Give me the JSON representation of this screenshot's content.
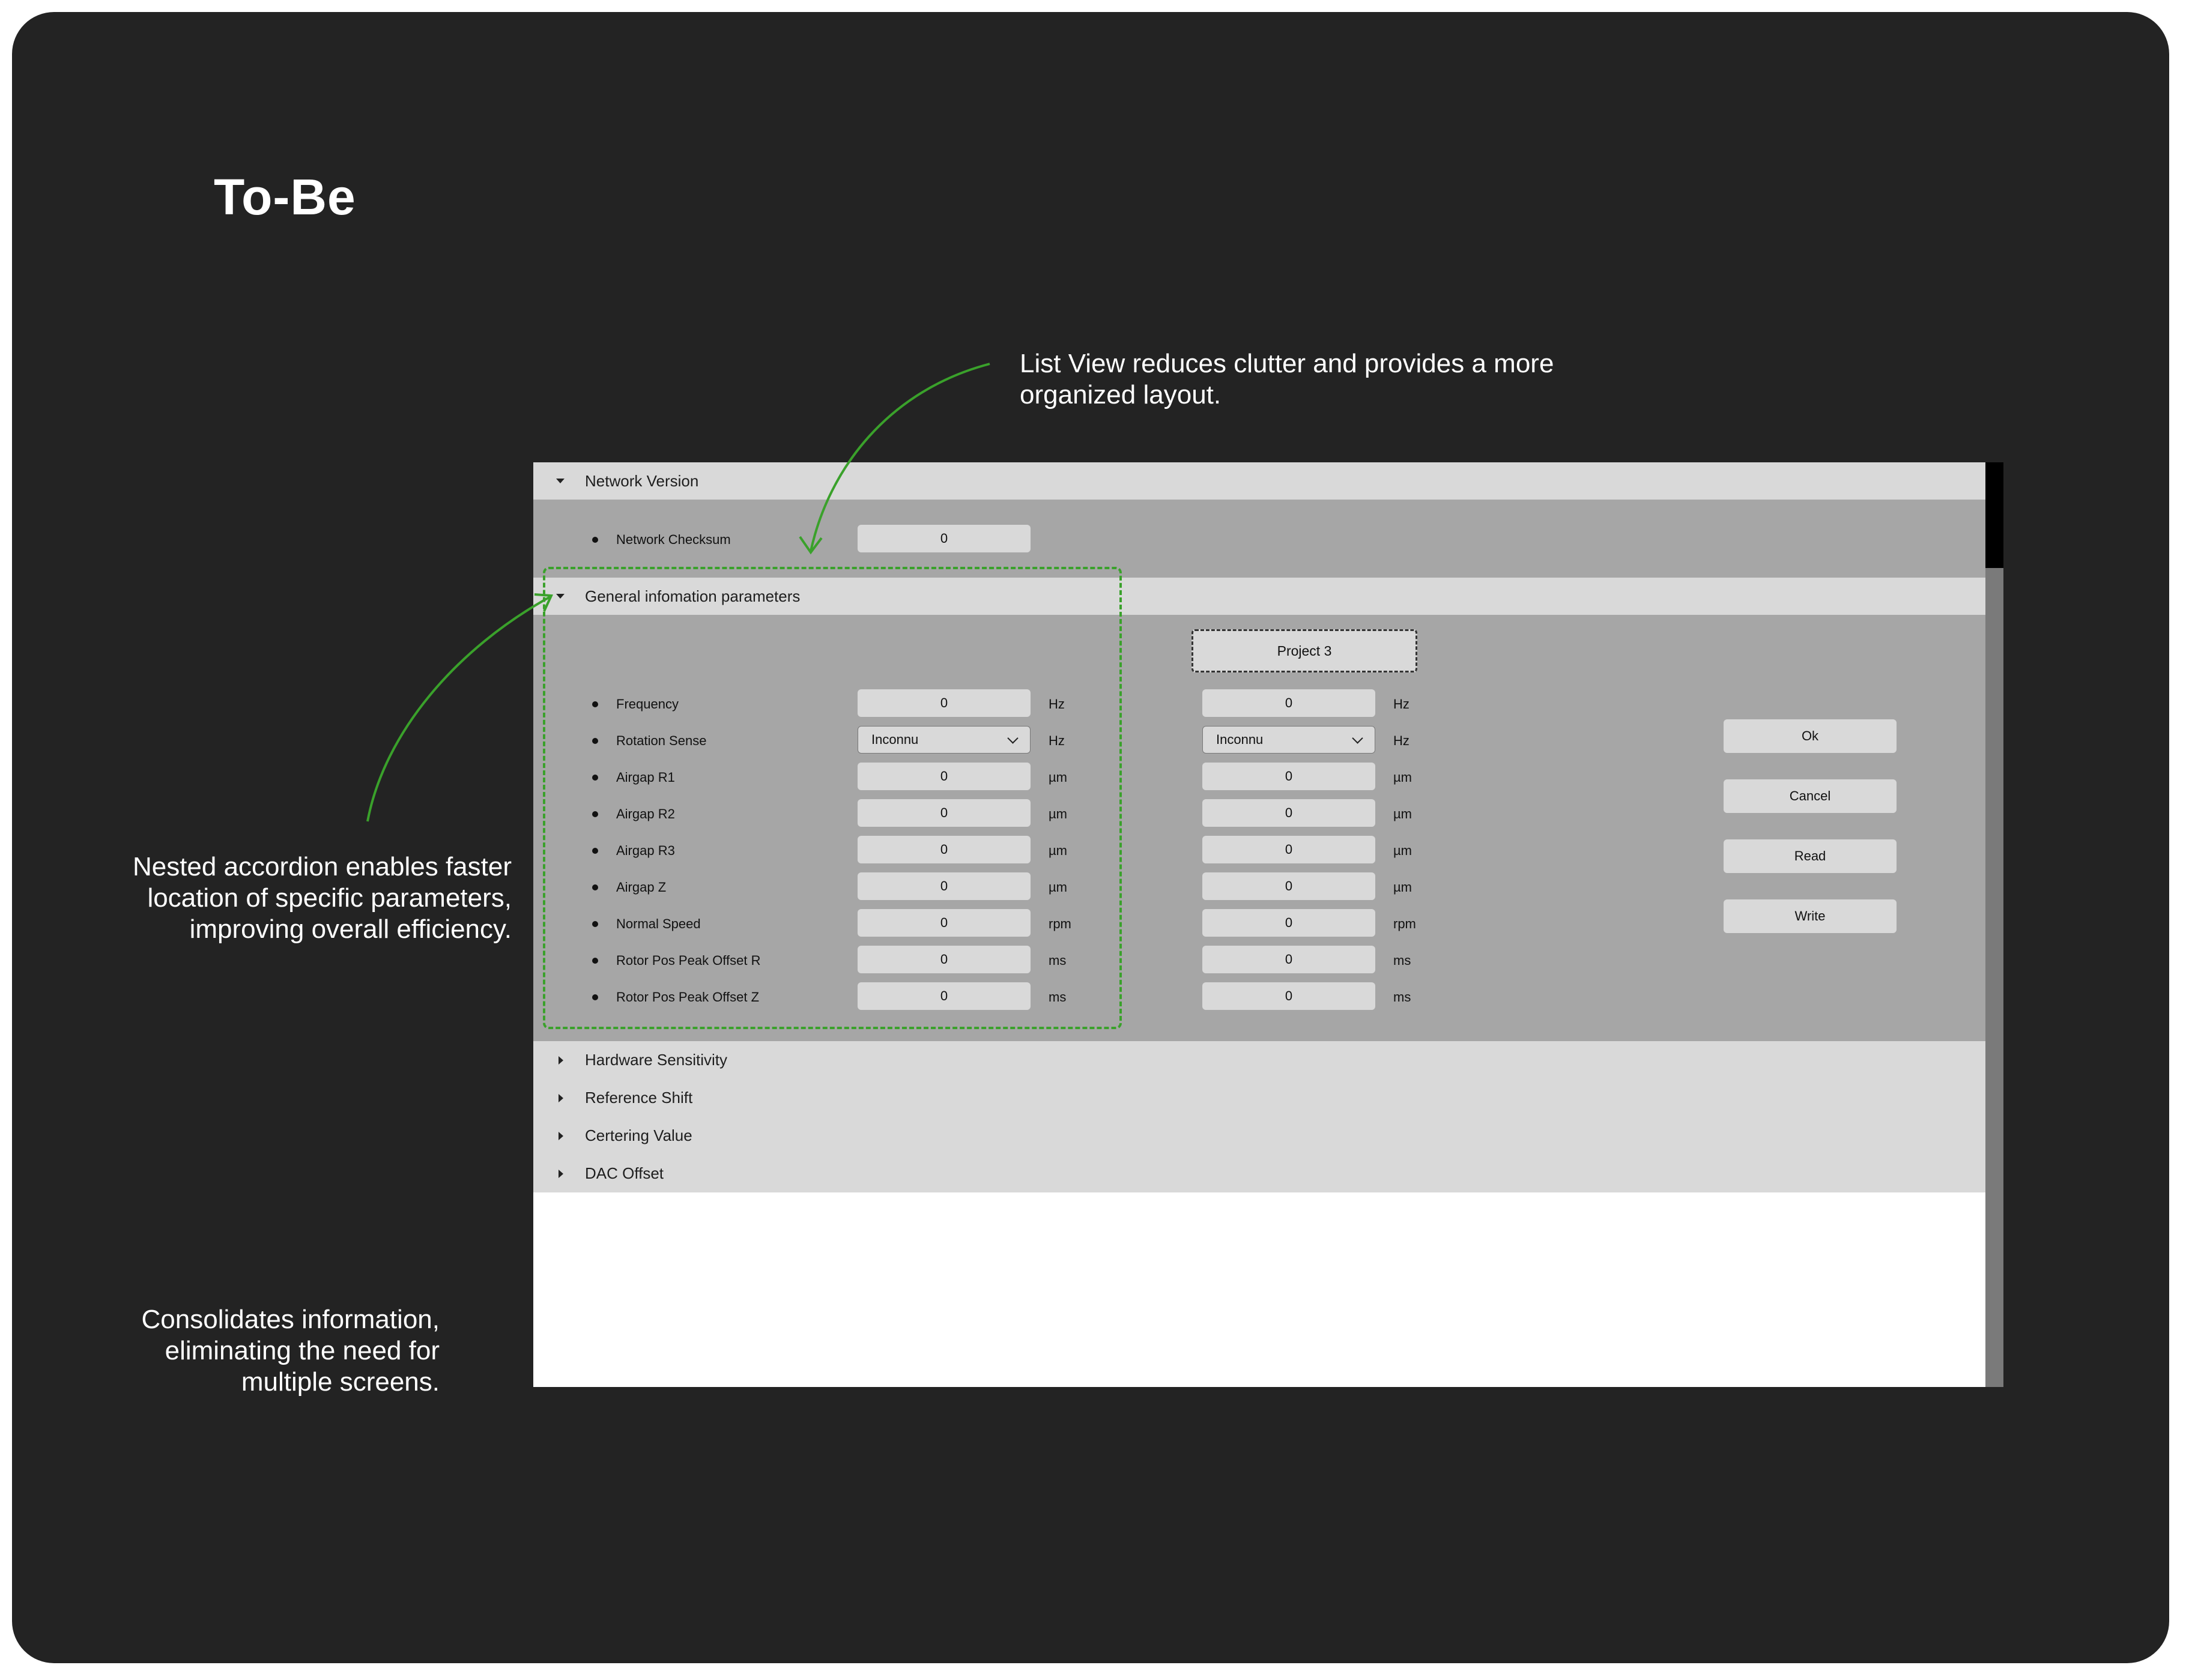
{
  "page": {
    "title": "To-Be",
    "notes": {
      "list_view": "List View reduces clutter and provides a more organized layout.",
      "nested_accordion": "Nested accordion enables faster location of specific parameters, improving overall efficiency.",
      "consolidates": "Consolidates information, eliminating the need for multiple screens."
    },
    "annotation_color": "#3aa12b"
  },
  "app": {
    "sections": {
      "network_version": {
        "label": "Network Version",
        "expanded": true,
        "rows": [
          {
            "label": "Network Checksum",
            "value": "0"
          }
        ]
      },
      "general": {
        "label": "General infomation parameters",
        "expanded": true,
        "project_label": "Project 3",
        "rows": [
          {
            "label": "Frequency",
            "value1": "0",
            "unit1": "Hz",
            "value2": "0",
            "unit2": "Hz"
          },
          {
            "label": "Rotation Sense",
            "value1": "Inconnu",
            "unit1": "Hz",
            "value2": "Inconnu",
            "unit2": "Hz"
          },
          {
            "label": "Airgap R1",
            "value1": "0",
            "unit1": "µm",
            "value2": "0",
            "unit2": "µm"
          },
          {
            "label": "Airgap R2",
            "value1": "0",
            "unit1": "µm",
            "value2": "0",
            "unit2": "µm"
          },
          {
            "label": "Airgap R3",
            "value1": "0",
            "unit1": "µm",
            "value2": "0",
            "unit2": "µm"
          },
          {
            "label": "Airgap Z",
            "value1": "0",
            "unit1": "µm",
            "value2": "0",
            "unit2": "µm"
          },
          {
            "label": "Normal Speed",
            "value1": "0",
            "unit1": "rpm",
            "value2": "0",
            "unit2": "rpm"
          },
          {
            "label": "Rotor Pos Peak Offset R",
            "value1": "0",
            "unit1": "ms",
            "value2": "0",
            "unit2": "ms"
          },
          {
            "label": "Rotor Pos Peak Offset Z",
            "value1": "0",
            "unit1": "ms",
            "value2": "0",
            "unit2": "ms"
          }
        ],
        "actions": [
          "Ok",
          "Cancel",
          "Read",
          "Write"
        ]
      },
      "collapsed": [
        "Hardware Sensitivity",
        "Reference Shift",
        "Certering Value",
        "DAC Offset"
      ]
    }
  }
}
